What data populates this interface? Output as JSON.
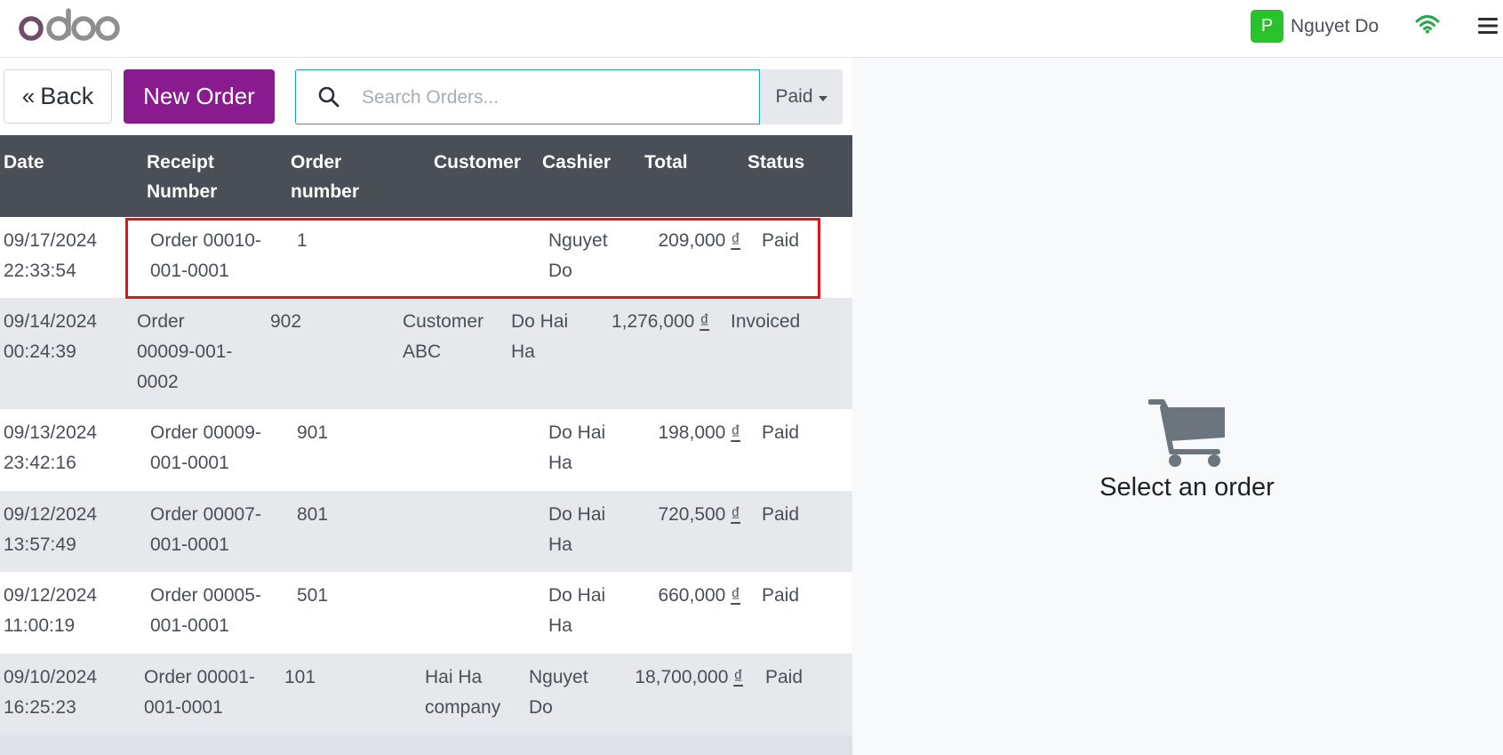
{
  "navbar": {
    "logo_icon": "odoo-logo",
    "user": {
      "initial": "P",
      "name": "Nguyet Do",
      "avatar_color": "#28c22a"
    },
    "wifi_icon": "wifi-icon",
    "menu_icon": "hamburger-menu-icon"
  },
  "controls": {
    "back_label": "Back",
    "back_icon": "double-chevron-left-icon",
    "new_order_label": "New Order",
    "search_placeholder": "Search Orders...",
    "search_value": "",
    "filter_value": "Paid"
  },
  "table": {
    "headers": {
      "date": "Date",
      "receipt_1": "Receipt",
      "receipt_2": "Number",
      "order_1": "Order",
      "order_2": "number",
      "customer": "Customer",
      "cashier": "Cashier",
      "total": "Total",
      "status": "Status"
    },
    "rows": [
      {
        "date_1": "09/17/2024",
        "date_2": "22:33:54",
        "receipt_1": "Order 00010-",
        "receipt_2": "001-0001",
        "receipt_3": "",
        "order_number": "1",
        "customer_1": "",
        "customer_2": "",
        "cashier_1": "Nguyet",
        "cashier_2": "Do",
        "total_amount": "209,000",
        "currency": "₫",
        "status": "Paid"
      },
      {
        "date_1": "09/14/2024",
        "date_2": "00:24:39",
        "receipt_1": "Order",
        "receipt_2": "00009-001-",
        "receipt_3": "0002",
        "order_number": "902",
        "customer_1": "Customer",
        "customer_2": "ABC",
        "cashier_1": "Do Hai",
        "cashier_2": "Ha",
        "total_amount": "1,276,000",
        "currency": "₫",
        "status": "Invoiced"
      },
      {
        "date_1": "09/13/2024",
        "date_2": "23:42:16",
        "receipt_1": "Order 00009-",
        "receipt_2": "001-0001",
        "receipt_3": "",
        "order_number": "901",
        "customer_1": "",
        "customer_2": "",
        "cashier_1": "Do Hai",
        "cashier_2": "Ha",
        "total_amount": "198,000",
        "currency": "₫",
        "status": "Paid"
      },
      {
        "date_1": "09/12/2024",
        "date_2": "13:57:49",
        "receipt_1": "Order 00007-",
        "receipt_2": "001-0001",
        "receipt_3": "",
        "order_number": "801",
        "customer_1": "",
        "customer_2": "",
        "cashier_1": "Do Hai",
        "cashier_2": "Ha",
        "total_amount": "720,500",
        "currency": "₫",
        "status": "Paid"
      },
      {
        "date_1": "09/12/2024",
        "date_2": "11:00:19",
        "receipt_1": "Order 00005-",
        "receipt_2": "001-0001",
        "receipt_3": "",
        "order_number": "501",
        "customer_1": "",
        "customer_2": "",
        "cashier_1": "Do Hai",
        "cashier_2": "Ha",
        "total_amount": "660,000",
        "currency": "₫",
        "status": "Paid"
      },
      {
        "date_1": "09/10/2024",
        "date_2": "16:25:23",
        "receipt_1": "Order 00001-",
        "receipt_2": "001-0001",
        "receipt_3": "",
        "order_number": "101",
        "customer_1": "Hai Ha",
        "customer_2": "company",
        "cashier_1": "Nguyet",
        "cashier_2": "Do",
        "total_amount": "18,700,000",
        "currency": "₫",
        "status": "Paid"
      }
    ]
  },
  "empty_state": {
    "icon": "shopping-cart-icon",
    "label": "Select an order"
  },
  "colors": {
    "brand_purple": "#8a1b8f",
    "header_bg": "#4a4f57",
    "highlight_red": "#e0151c",
    "search_border": "#17a2b8"
  }
}
